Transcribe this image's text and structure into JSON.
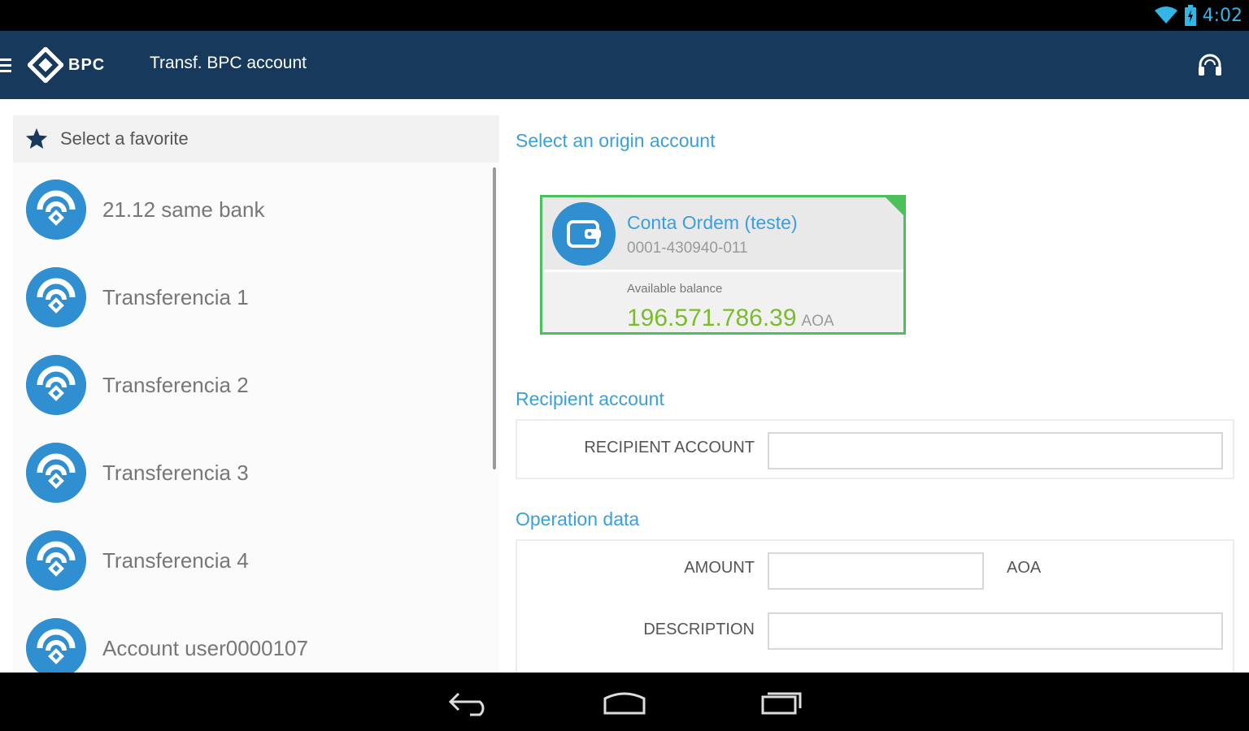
{
  "status_bar": {
    "time": "4:02",
    "icons": [
      "wifi-icon",
      "battery-icon"
    ]
  },
  "app_bar": {
    "logo_text": "BPC",
    "title": "Transf. BPC account",
    "icons": [
      "menu-icon",
      "headset-icon"
    ]
  },
  "favorites": {
    "header_label": "Select a favorite",
    "header_icon": "star-icon",
    "items": [
      {
        "label": "21.12 same bank"
      },
      {
        "label": "Transferencia 1"
      },
      {
        "label": "Transferencia 2"
      },
      {
        "label": "Transferencia 3"
      },
      {
        "label": "Transferencia 4"
      },
      {
        "label": "Account user0000107"
      }
    ]
  },
  "origin": {
    "title": "Select an origin account",
    "account": {
      "name": "Conta Ordem (teste)",
      "number": "0001-430940-011",
      "balance_label": "Available balance",
      "balance": "196.571.786.39",
      "currency": "AOA"
    }
  },
  "recipient": {
    "title": "Recipient account",
    "field_label": "RECIPIENT ACCOUNT",
    "field_value": ""
  },
  "operation": {
    "title": "Operation data",
    "amount_label": "AMOUNT",
    "amount_value": "",
    "amount_currency": "AOA",
    "description_label": "DESCRIPTION",
    "description_value": ""
  },
  "nav_bar": {
    "icons": [
      "back-icon",
      "home-icon",
      "recents-icon"
    ]
  },
  "colors": {
    "app_bar": "#173a5c",
    "accent_blue": "#3aa0db",
    "avatar_blue": "#2f8fd0",
    "selected_green": "#4cc05a",
    "balance_green": "#7dbb2e",
    "status_blue": "#33b5e5"
  }
}
